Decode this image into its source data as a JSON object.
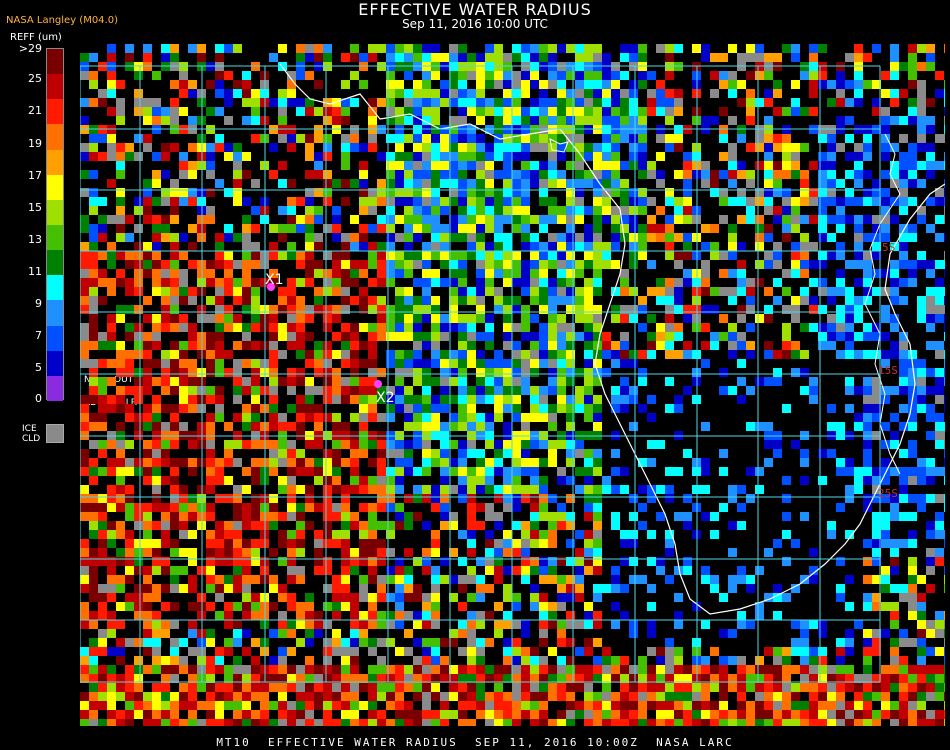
{
  "header": {
    "title": "EFFECTIVE WATER RADIUS",
    "subtitle": "Sep 11, 2016 10:00 UTC",
    "org": "NASA Langley (M04.0)"
  },
  "legend": {
    "units": "REFF (um)",
    "tick_labels": [
      ">29",
      "25",
      "21",
      "19",
      "17",
      "15",
      "13",
      "11",
      "9",
      "7",
      "5",
      "0"
    ],
    "colors": [
      "#7a0000",
      "#c00000",
      "#ff1a00",
      "#ff7000",
      "#ffa000",
      "#ffff00",
      "#a0e000",
      "#44c000",
      "#008000",
      "#00ffff",
      "#1e90ff",
      "#0050ff",
      "#0000c8",
      "#8a2be2"
    ],
    "no_ret_top": "NO",
    "no_ret_bottom": "RET",
    "out_valr_top": "OUT",
    "out_valr_bottom": "VALR",
    "ice_top": "ICE",
    "ice_bottom": "CLD",
    "ice_color": "#8a8a8a"
  },
  "markers": [
    {
      "label": "X1",
      "color": "#ff40ff"
    },
    {
      "label": "X2",
      "color": "#ff40ff"
    }
  ],
  "grid_labels": [
    "5S",
    "15S",
    "25S"
  ],
  "footer": "MT10  EFFECTIVE WATER RADIUS  SEP 11, 2016 10:00Z  NASA LARC",
  "colors": {
    "grid": "#4fd8e8",
    "coast": "#ffffff",
    "grid_label": "#c83232",
    "no_data": "#000000"
  }
}
